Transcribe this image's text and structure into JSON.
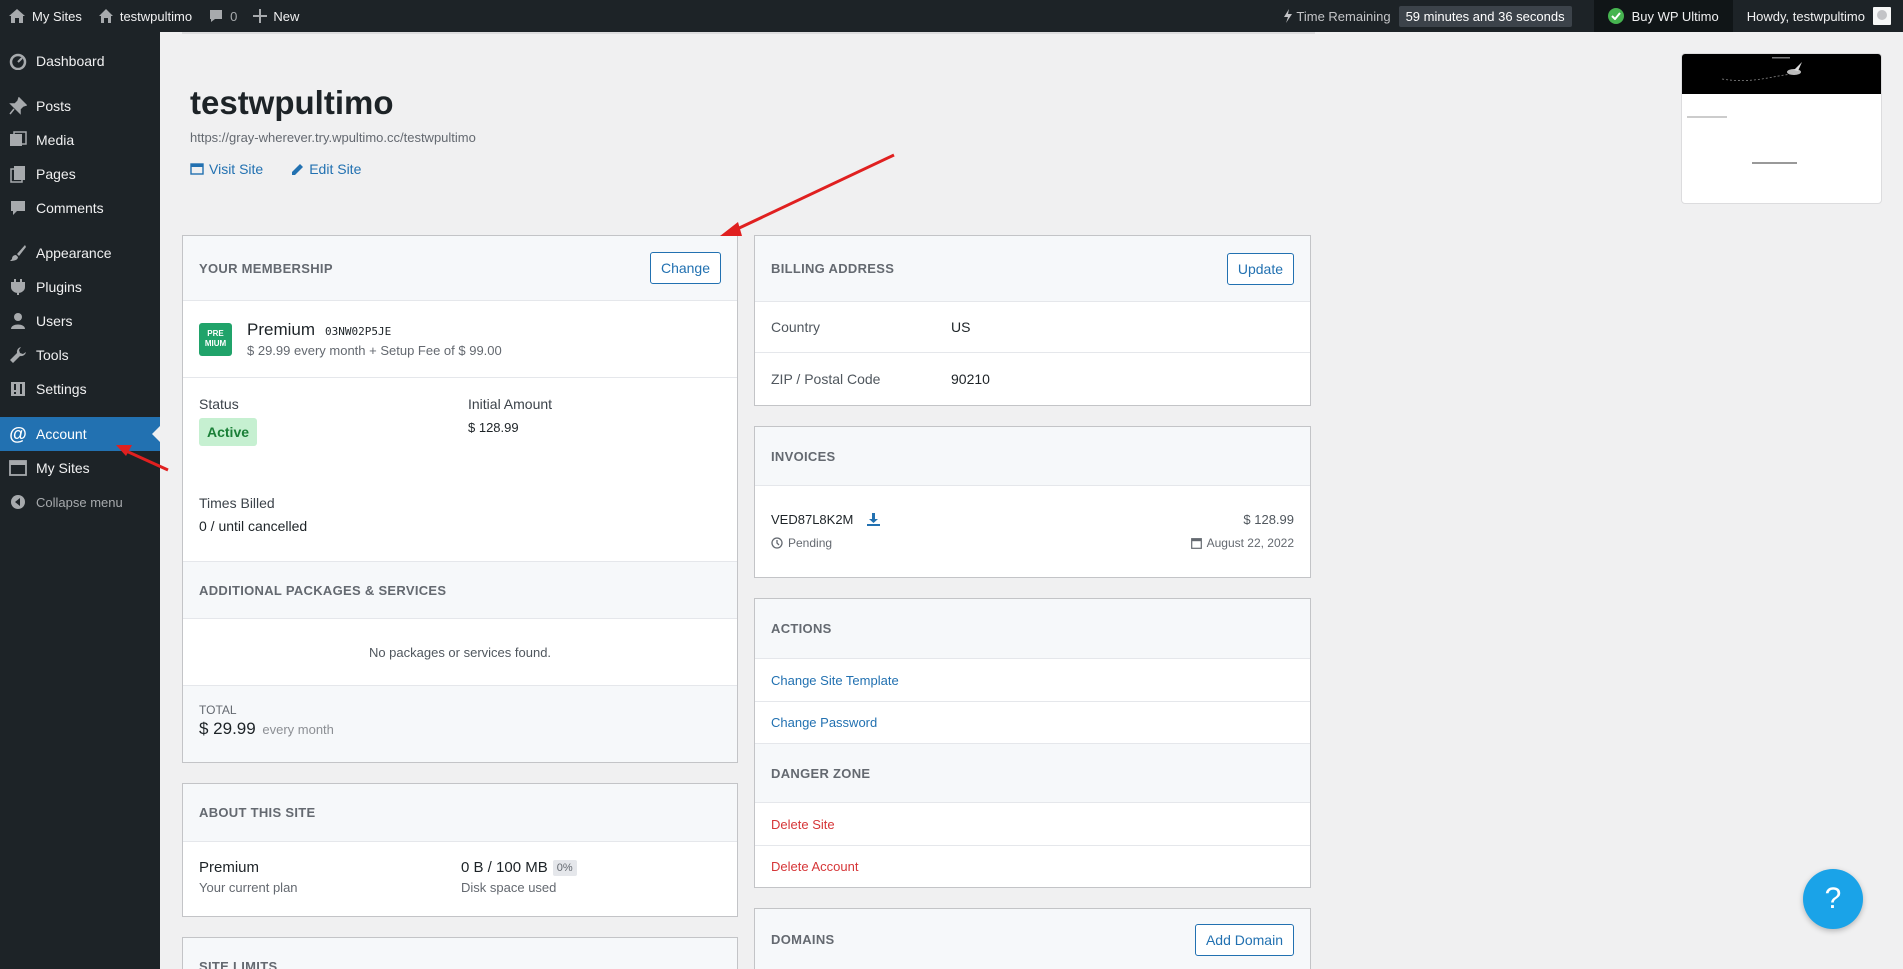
{
  "adminbar": {
    "my_sites": "My Sites",
    "site_name": "testwpultimo",
    "comments_count": "0",
    "new_label": "New",
    "time_remaining_label": "Time Remaining",
    "time_remaining_value": "59 minutes and 36 seconds",
    "buy_label": "Buy WP Ultimo",
    "howdy": "Howdy, testwpultimo"
  },
  "sidebar": {
    "items": [
      {
        "label": "Dashboard",
        "icon": "dashboard-icon"
      },
      {
        "label": "Posts",
        "icon": "pin-icon"
      },
      {
        "label": "Media",
        "icon": "media-icon"
      },
      {
        "label": "Pages",
        "icon": "pages-icon"
      },
      {
        "label": "Comments",
        "icon": "comment-icon"
      },
      {
        "label": "Appearance",
        "icon": "brush-icon"
      },
      {
        "label": "Plugins",
        "icon": "plugin-icon"
      },
      {
        "label": "Users",
        "icon": "user-icon"
      },
      {
        "label": "Tools",
        "icon": "wrench-icon"
      },
      {
        "label": "Settings",
        "icon": "settings-icon"
      },
      {
        "label": "Account",
        "icon": "at-icon"
      },
      {
        "label": "My Sites",
        "icon": "window-icon"
      },
      {
        "label": "Collapse menu",
        "icon": "collapse-icon"
      }
    ]
  },
  "site": {
    "title": "testwpultimo",
    "url": "https://gray-wherever.try.wpultimo.cc/testwpultimo",
    "visit_label": "Visit Site",
    "edit_label": "Edit Site"
  },
  "membership": {
    "heading": "YOUR MEMBERSHIP",
    "change_label": "Change",
    "badge_text_1": "PRE",
    "badge_text_2": "MIUM",
    "plan_name": "Premium",
    "code": "03NW02P5JE",
    "price_desc": "$ 29.99 every month + Setup Fee of $ 99.00",
    "status_label": "Status",
    "status_value": "Active",
    "initial_label": "Initial Amount",
    "initial_value": "$ 128.99",
    "billed_label": "Times Billed",
    "billed_value": "0 / until cancelled",
    "packages_heading": "ADDITIONAL PACKAGES & SERVICES",
    "packages_empty": "No packages or services found.",
    "total_label": "TOTAL",
    "total_value": "$ 29.99",
    "total_period": "every month"
  },
  "about": {
    "heading": "ABOUT THIS SITE",
    "plan_value": "Premium",
    "plan_label": "Your current plan",
    "disk_value": "0 B / 100 MB",
    "disk_percent": "0%",
    "disk_label": "Disk space used"
  },
  "site_limits": {
    "heading": "SITE LIMITS"
  },
  "billing": {
    "heading": "BILLING ADDRESS",
    "update_label": "Update",
    "country_label": "Country",
    "country_value": "US",
    "zip_label": "ZIP / Postal Code",
    "zip_value": "90210"
  },
  "invoices": {
    "heading": "INVOICES",
    "items": [
      {
        "code": "VED87L8K2M",
        "status": "Pending",
        "amount": "$ 128.99",
        "date": "August 22, 2022"
      }
    ]
  },
  "actions": {
    "heading": "ACTIONS",
    "change_template": "Change Site Template",
    "change_password": "Change Password",
    "danger_heading": "DANGER ZONE",
    "delete_site": "Delete Site",
    "delete_account": "Delete Account"
  },
  "domains": {
    "heading": "DOMAINS",
    "add_label": "Add Domain"
  },
  "help": {
    "label": "?"
  },
  "colors": {
    "admin_bg": "#1d2327",
    "accent": "#2271b1",
    "danger": "#d63638",
    "premium_badge": "#20a36a",
    "help_button": "#1aa3e8",
    "annotation_arrow": "#e02020"
  }
}
